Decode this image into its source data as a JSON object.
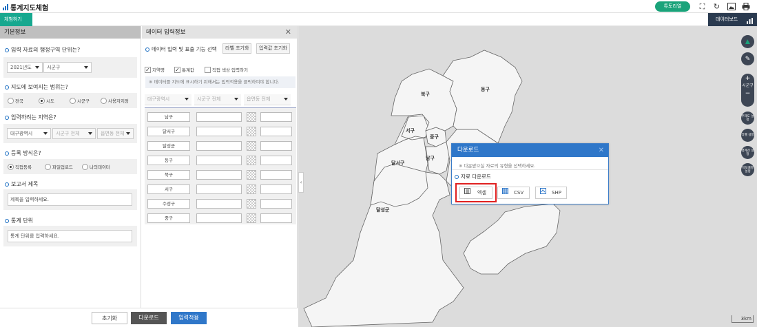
{
  "app": {
    "title": "통계지도체험",
    "tutorial": "튜토리얼"
  },
  "subbar": {
    "try": "체험하기",
    "dashboard": "데이터보드"
  },
  "left": {
    "header": "기본정보",
    "q1": "입력 자료의 행정구역 단위는?",
    "year": "2021년도",
    "unit": "시군구",
    "q2": "지도에 보여지는 범위는?",
    "scope": [
      "전국",
      "시도",
      "시군구",
      "사용자지정"
    ],
    "q3": "입력하려는 지역은?",
    "sido": "대구광역시",
    "sgg": "시군구 전체",
    "emd": "읍면동 전체",
    "q4": "등록 방식은?",
    "method": [
      "직접등록",
      "파일업로드",
      "나의데이터"
    ],
    "q5": "보고서 제목",
    "title_ph": "제목을 입력하세요.",
    "q6": "통계 단위",
    "unit_ph": "통계 단위를 입력하세요."
  },
  "mid": {
    "header": "데이터 입력정보",
    "select": "데이터 입력 및 표출 기능 선택",
    "reset_label": "라벨 초기화",
    "reset_input": "입력값 초기화",
    "chk": [
      "지역명",
      "통계값",
      "직접 색상 입력하기"
    ],
    "note": "※ 데이터를 지도에 표시하기 위해서는 입력적용을 클릭하여야 합니다.",
    "f1": "대구광역시",
    "f2": "시군구 전체",
    "f3": "읍면동 전체",
    "rows": [
      "남구",
      "달서구",
      "달성군",
      "동구",
      "북구",
      "서구",
      "수성구",
      "중구"
    ]
  },
  "footer": {
    "reset": "초기화",
    "download": "다운로드",
    "apply": "입력적용"
  },
  "map": {
    "labels": {
      "bukgu": "북구",
      "donggu": "동구",
      "seogu": "서구",
      "junggu": "중구",
      "dalseogu": "달서구",
      "namgu": "남구",
      "dalseonggun": "달성군"
    },
    "zoom_label": "시군구",
    "plus": "+",
    "minus": "−",
    "tools": [
      "주제도 설정",
      "라벨 설정",
      "경계선 설정",
      "지도배경 설정"
    ],
    "scale": "3km"
  },
  "dialog": {
    "title": "다운로드",
    "desc": "※ 다운받으실 자료의 유형을 선택하세요.",
    "section": "자료 다운로드",
    "excel": "엑셀",
    "csv": "CSV",
    "shp": "SHP"
  }
}
